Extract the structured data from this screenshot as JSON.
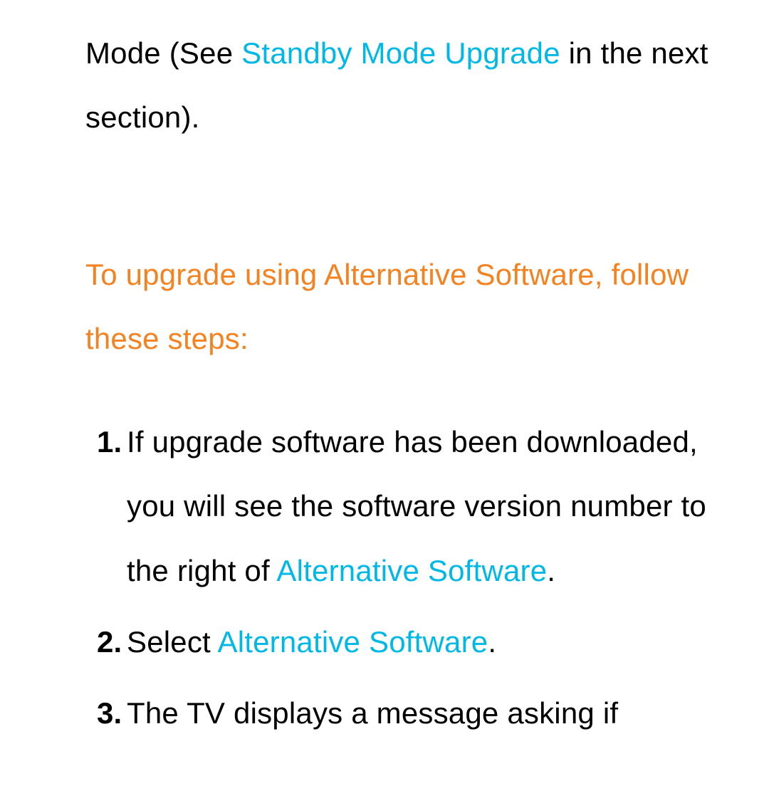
{
  "intro": {
    "part1": "Mode (See ",
    "link": "Standby Mode Upgrade",
    "part2": " in the next section)."
  },
  "heading": "To upgrade using Alternative Software, follow these steps:",
  "steps": [
    {
      "num": "1.",
      "part1": "If upgrade software has been downloaded, you will see the software version number to the right of ",
      "link": "Alternative Software",
      "part2": "."
    },
    {
      "num": "2.",
      "part1": "Select ",
      "link": "Alternative Software",
      "part2": "."
    },
    {
      "num": "3.",
      "part1": "The TV displays a message asking if",
      "link": "",
      "part2": ""
    }
  ]
}
